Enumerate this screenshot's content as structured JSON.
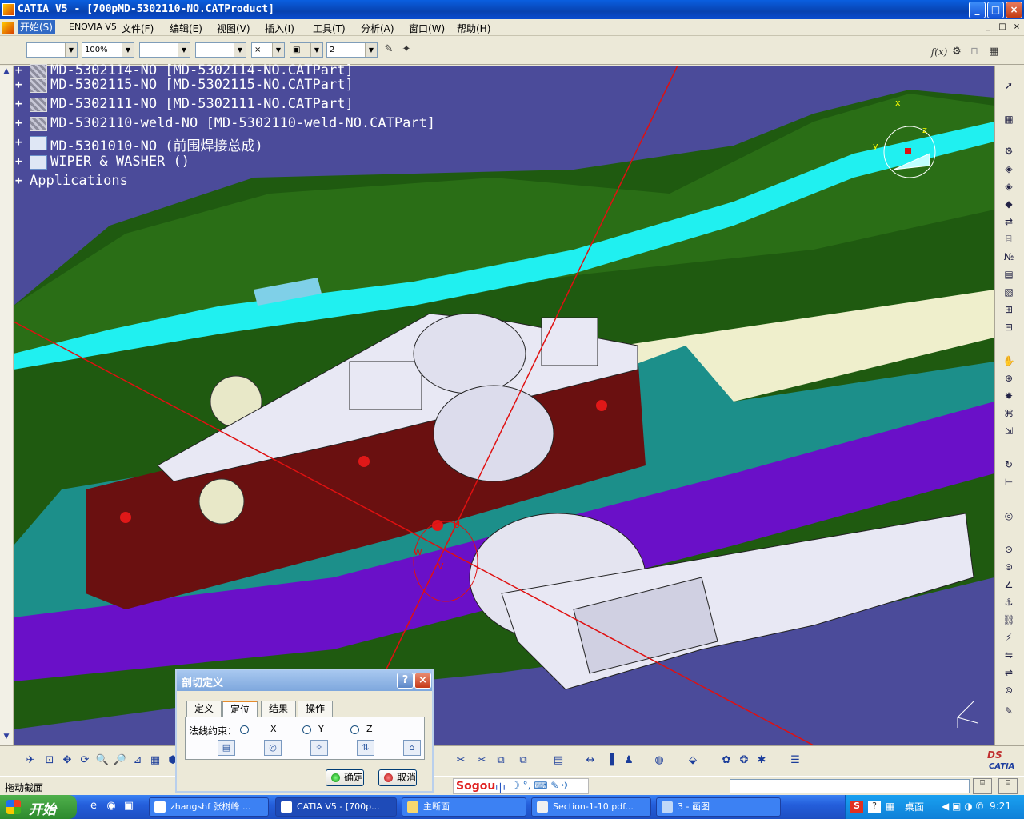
{
  "window": {
    "title": "CATIA V5 - [700pMD-5302110-NO.CATProduct]",
    "buttons": {
      "minimize": "_",
      "maximize": "□",
      "close": "×"
    }
  },
  "menu": {
    "items": [
      "开始(S)",
      "ENOVIA V5",
      "文件(F)",
      "编辑(E)",
      "视图(V)",
      "插入(I)",
      "工具(T)",
      "分析(A)",
      "窗口(W)",
      "帮助(H)"
    ],
    "mdi_buttons": [
      "_",
      "□",
      "×"
    ]
  },
  "toolbar": {
    "line_color": "",
    "zoom_value": "100%",
    "line_weight": "",
    "line_type": "",
    "point_symbol": "×",
    "layer_value": "2",
    "right_icon_fx": "f(x)"
  },
  "tree": {
    "rows": [
      {
        "label": "MD-5302114-NO [MD-5302114-NO.CATPart]",
        "type": "part"
      },
      {
        "label": "MD-5302115-NO [MD-5302115-NO.CATPart]",
        "type": "part"
      },
      {
        "label": "MD-5302111-NO [MD-5302111-NO.CATPart]",
        "type": "part"
      },
      {
        "label": "MD-5302110-weld-NO [MD-5302110-weld-NO.CATPart]",
        "type": "part"
      },
      {
        "label": "MD-5301010-NO (前围焊接总成)",
        "type": "product"
      },
      {
        "label": "WIPER & WASHER ()",
        "type": "product"
      },
      {
        "label": "Applications",
        "type": "apps"
      }
    ]
  },
  "compass": {
    "x": "x",
    "y": "y",
    "z": "z"
  },
  "section_axes": {
    "u": "U",
    "v": "V",
    "w": "W"
  },
  "dialog": {
    "title": "剖切定义",
    "help": "?",
    "close": "×",
    "tabs": [
      "定义",
      "定位",
      "结果",
      "操作"
    ],
    "active_tab": "定位",
    "normal_constraint_label": "法线约束：",
    "radio_options": [
      "X",
      "Y",
      "Z"
    ],
    "ok_label": "确定",
    "cancel_label": "取消"
  },
  "status": {
    "text": "拖动截面",
    "ime_logo": "Sogou",
    "ime_mode": "中"
  },
  "brand": {
    "ds": "DS",
    "catia": "CATIA"
  },
  "taskbar": {
    "start_label": "开始",
    "tasks": [
      {
        "label": "zhangshf 张树峰 ..."
      },
      {
        "label": "CATIA V5 - [700p..."
      },
      {
        "label": "主断面"
      },
      {
        "label": "Section-1-10.pdf..."
      },
      {
        "label": "3 - 画图"
      }
    ],
    "tray_desktop": "桌面",
    "clock": "9:21"
  },
  "colors": {
    "viewport_bg": "#4b4b9a",
    "green_panel": "#1f5a10",
    "cyan": "#20f0f0",
    "dark_red": "#6a1010",
    "purple": "#6a10c8",
    "white_part": "#e8e8f4",
    "section_line": "#e01010"
  }
}
